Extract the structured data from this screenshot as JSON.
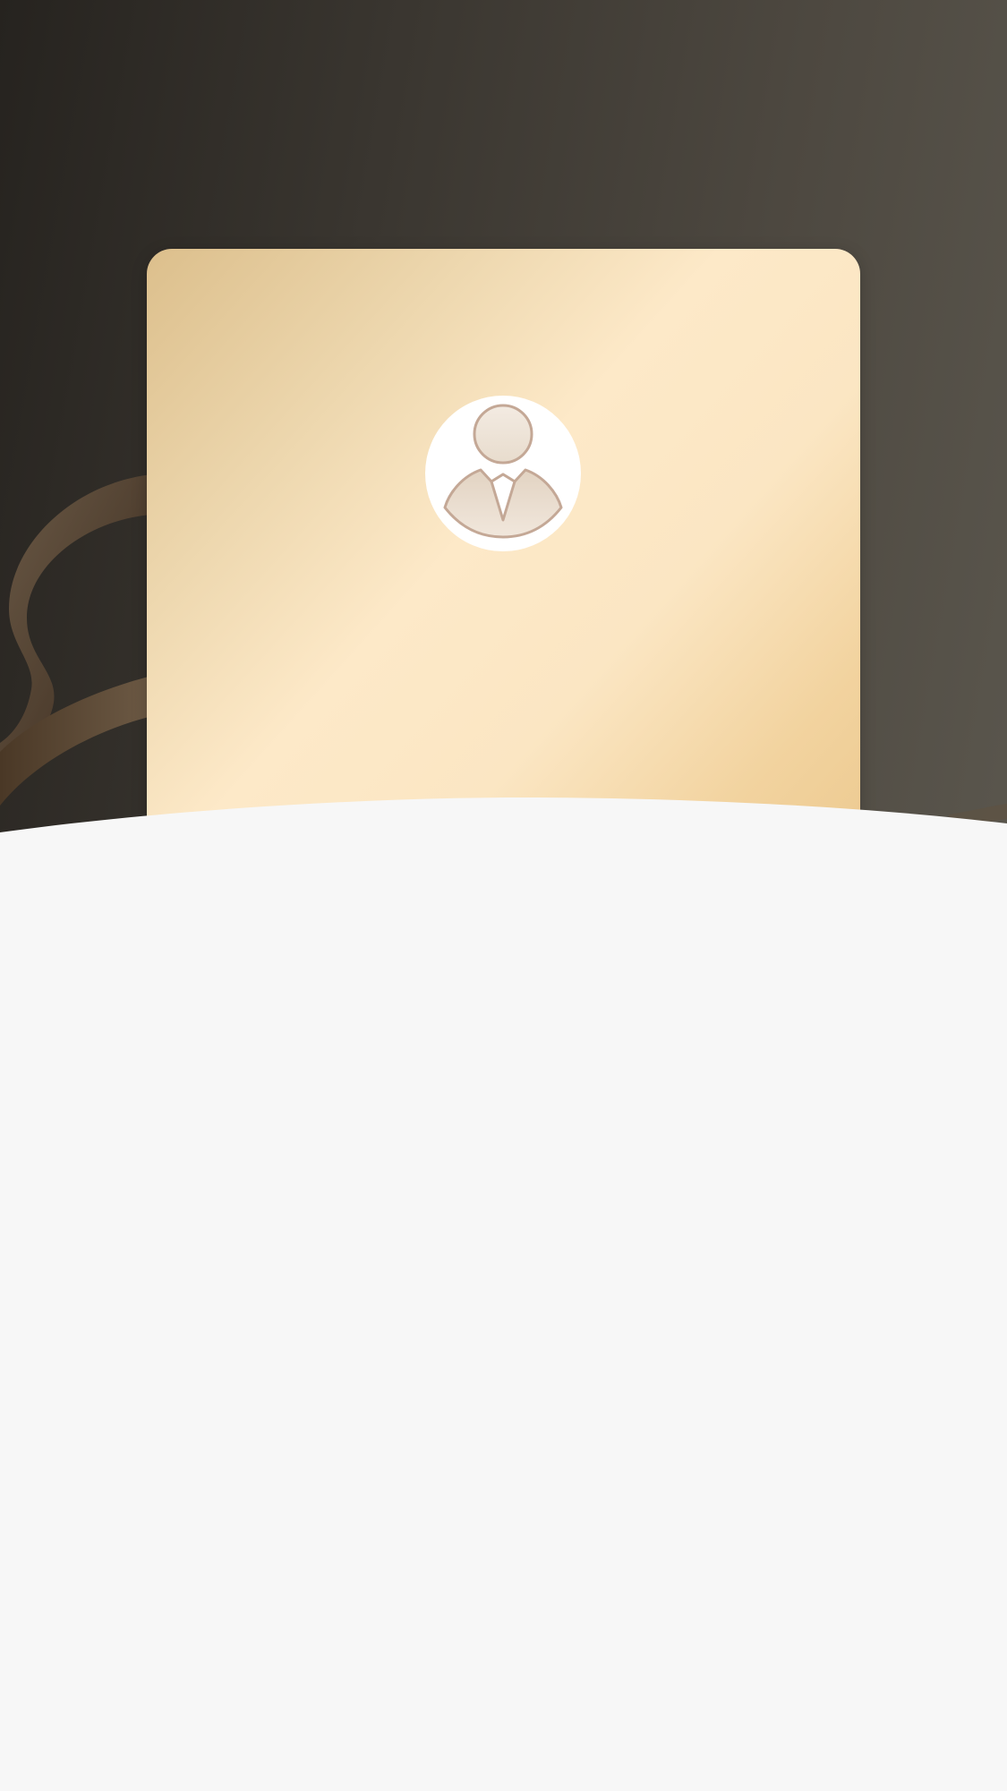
{
  "header": {
    "background_colors": [
      "#26231f",
      "#5a564d"
    ]
  },
  "member_card": {
    "gradient_colors": [
      "#dcbf8c",
      "#fde9c8",
      "#ecc98f"
    ],
    "avatar": {
      "icon": "user-silhouette-icon",
      "stroke_color": "#c4a896",
      "fill_color": "#ecdfd0"
    }
  },
  "content_sheet": {
    "background_color": "#f7f7f7"
  }
}
